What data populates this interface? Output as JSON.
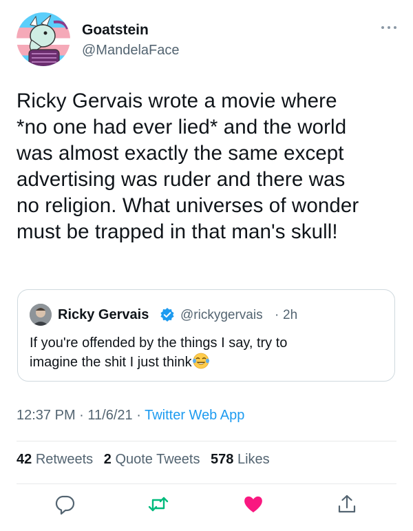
{
  "author": {
    "name": "Goatstein",
    "handle": "@MandelaFace"
  },
  "tweet": {
    "lines": [
      "Ricky Gervais wrote a movie where",
      "*no one had ever lied* and the world",
      "was almost exactly the same except",
      "advertising was ruder and there was",
      "no religion. What universes of wonder",
      "must be trapped in that man's skull!"
    ]
  },
  "quote": {
    "name": "Ricky Gervais",
    "handle": "@rickygervais",
    "separator": "·",
    "time": "2h",
    "line1": "If you're offended by the things I say, try to",
    "line2": "imagine the shit I just think"
  },
  "meta": {
    "time": "12:37 PM",
    "date": "11/6/21",
    "separator": "·",
    "app": "Twitter Web App"
  },
  "stats": {
    "retweets_count": "42",
    "retweets_label": "Retweets",
    "quotes_count": "2",
    "quotes_label": "Quote Tweets",
    "likes_count": "578",
    "likes_label": "Likes"
  },
  "icons": {
    "more": "more-horizontal-icon",
    "verified": "verified-badge-icon",
    "emoji": "face-with-tears-of-joy-icon",
    "reply": "reply-icon",
    "retweet": "retweet-icon",
    "like": "heart-icon",
    "share": "share-icon"
  },
  "colors": {
    "accent": "#1d9bf0",
    "retweet": "#00ba7c",
    "like": "#f91880",
    "secondary": "#536471"
  }
}
